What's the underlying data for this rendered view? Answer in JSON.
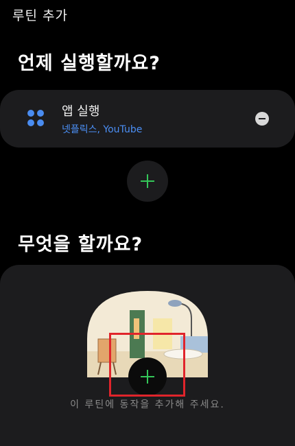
{
  "header": {
    "title": "루틴 추가"
  },
  "when_section": {
    "title": "언제 실행할까요?",
    "trigger": {
      "icon": "app-grid-icon",
      "title": "앱 실행",
      "subtitle": "넷플릭스, YouTube"
    },
    "add_icon": "plus-icon"
  },
  "what_section": {
    "title": "무엇을 할까요?",
    "add_icon": "plus-icon",
    "hint": "이 루틴에 동작을 추가해 주세요."
  },
  "colors": {
    "background": "#000000",
    "card": "#1c1c1e",
    "accent_blue": "#4b8ff5",
    "accent_green": "#34c759",
    "highlight": "#e0242b"
  }
}
